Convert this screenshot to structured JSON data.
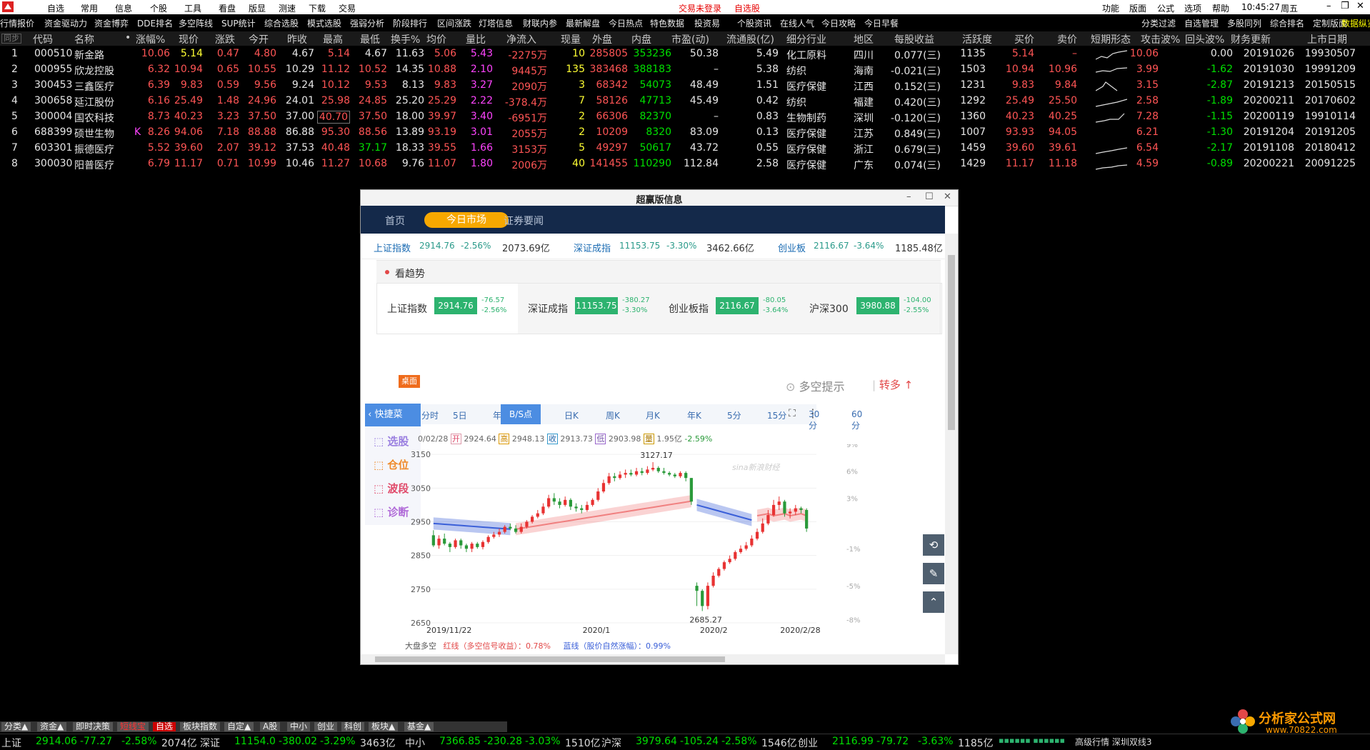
{
  "menubar": {
    "items": [
      "自选",
      "常用",
      "信息",
      "个股",
      "工具",
      "看盘",
      "版显",
      "测速",
      "下载",
      "交易"
    ],
    "status_notlogged": "交易未登录",
    "self_pick_stock": "自选股",
    "right_items": [
      "功能",
      "版面",
      "公式",
      "选项",
      "帮助"
    ],
    "time": "10:45:27",
    "weekday": "周五"
  },
  "toolbar": {
    "left": [
      "行情报价",
      "资金驱动力",
      "资金博弈",
      "DDE排名",
      "多空阵线",
      "SUP统计",
      "综合选股",
      "模式选股",
      "强弱分析",
      "阶段排行",
      "区间涨跌",
      "灯塔信息",
      "财联内参",
      "最新解盘",
      "今日热点",
      "特色数据",
      "投资易",
      "个股资讯",
      "在线人气",
      "今日攻略",
      "今日早餐"
    ],
    "right": [
      "分类过滤",
      "自选管理",
      "多股同列",
      "综合排名",
      "定制版面",
      "数据纵览"
    ]
  },
  "table": {
    "sync_label": "同步",
    "columns": [
      "代码",
      "名称",
      "•",
      "涨幅%",
      "现价",
      "涨跌",
      "今开",
      "昨收",
      "最高",
      "最低",
      "换手%",
      "均价",
      "量比",
      "净流入",
      "现量",
      "外盘",
      "内盘",
      "市盈(动)",
      "流通股(亿)",
      "细分行业",
      "地区",
      "每股收益",
      "活跃度",
      "买价",
      "卖价",
      "短期形态",
      "攻击波%",
      "回头波%",
      "财务更新",
      "上市日期"
    ],
    "rows": [
      {
        "no": "1",
        "code": "000510",
        "name": "新金路",
        "flag": "",
        "chg_pct": "10.06",
        "price": "5.14",
        "chg": "0.47",
        "open": "4.80",
        "pre_close": "4.67",
        "high": "5.14",
        "low": "4.67",
        "turnover": "11.63",
        "avg": "5.06",
        "vol_ratio": "5.43",
        "net_in": "-2275万",
        "cur_vol": "10",
        "outer": "285805",
        "inner": "353236",
        "pe": "50.38",
        "float_shares": "5.49",
        "industry": "化工原料",
        "region": "四川",
        "eps": "0.077(三)",
        "activity": "1135",
        "bid": "5.14",
        "ask": "–",
        "attack": "10.06",
        "pullback": "0.00",
        "fin_update": "20191026",
        "list_date": "19930507"
      },
      {
        "no": "2",
        "code": "000955",
        "name": "欣龙控股",
        "flag": "",
        "chg_pct": "6.32",
        "price": "10.94",
        "chg": "0.65",
        "open": "10.55",
        "pre_close": "10.29",
        "high": "11.12",
        "low": "10.52",
        "turnover": "14.35",
        "avg": "10.88",
        "vol_ratio": "2.10",
        "net_in": "9445万",
        "cur_vol": "135",
        "outer": "383468",
        "inner": "388183",
        "pe": "–",
        "float_shares": "5.38",
        "industry": "纺织",
        "region": "海南",
        "eps": "-0.021(三)",
        "activity": "1503",
        "bid": "10.94",
        "ask": "10.96",
        "attack": "3.99",
        "pullback": "-1.62",
        "fin_update": "20191030",
        "list_date": "19991209"
      },
      {
        "no": "3",
        "code": "300453",
        "name": "三鑫医疗",
        "flag": "",
        "chg_pct": "6.39",
        "price": "9.83",
        "chg": "0.59",
        "open": "9.56",
        "pre_close": "9.24",
        "high": "10.12",
        "low": "9.53",
        "turnover": "8.13",
        "avg": "9.83",
        "vol_ratio": "3.27",
        "net_in": "2090万",
        "cur_vol": "3",
        "outer": "68342",
        "inner": "54073",
        "pe": "48.49",
        "float_shares": "1.51",
        "industry": "医疗保健",
        "region": "江西",
        "eps": "0.152(三)",
        "activity": "1231",
        "bid": "9.83",
        "ask": "9.84",
        "attack": "3.15",
        "pullback": "-2.87",
        "fin_update": "20191213",
        "list_date": "20150515"
      },
      {
        "no": "4",
        "code": "300658",
        "name": "延江股份",
        "flag": "",
        "chg_pct": "6.16",
        "price": "25.49",
        "chg": "1.48",
        "open": "24.96",
        "pre_close": "24.01",
        "high": "25.98",
        "low": "24.85",
        "turnover": "25.20",
        "avg": "25.29",
        "vol_ratio": "2.22",
        "net_in": "-378.4万",
        "cur_vol": "7",
        "outer": "58126",
        "inner": "47713",
        "pe": "45.49",
        "float_shares": "0.42",
        "industry": "纺织",
        "region": "福建",
        "eps": "0.420(三)",
        "activity": "1292",
        "bid": "25.49",
        "ask": "25.50",
        "attack": "2.58",
        "pullback": "-1.89",
        "fin_update": "20200211",
        "list_date": "20170602"
      },
      {
        "no": "5",
        "code": "300004",
        "name": "国农科技",
        "flag": "",
        "chg_pct": "8.73",
        "price": "40.23",
        "chg": "3.23",
        "open": "37.50",
        "pre_close": "37.00",
        "high": "40.70",
        "low": "37.50",
        "turnover": "18.00",
        "avg": "39.97",
        "vol_ratio": "3.40",
        "net_in": "-6951万",
        "cur_vol": "2",
        "outer": "66306",
        "inner": "82370",
        "pe": "–",
        "float_shares": "0.83",
        "industry": "生物制药",
        "region": "深圳",
        "eps": "-0.120(三)",
        "activity": "1360",
        "bid": "40.23",
        "ask": "40.25",
        "attack": "7.28",
        "pullback": "-1.15",
        "fin_update": "20200119",
        "list_date": "19910114"
      },
      {
        "no": "6",
        "code": "688399",
        "name": "硕世生物",
        "flag": "K",
        "chg_pct": "8.26",
        "price": "94.06",
        "chg": "7.18",
        "open": "88.88",
        "pre_close": "86.88",
        "high": "95.30",
        "low": "88.56",
        "turnover": "13.89",
        "avg": "93.19",
        "vol_ratio": "3.01",
        "net_in": "2055万",
        "cur_vol": "2",
        "outer": "10209",
        "inner": "8320",
        "pe": "83.09",
        "float_shares": "0.13",
        "industry": "医疗保健",
        "region": "江苏",
        "eps": "0.849(三)",
        "activity": "1007",
        "bid": "93.93",
        "ask": "94.05",
        "attack": "6.21",
        "pullback": "-1.30",
        "fin_update": "20191204",
        "list_date": "20191205"
      },
      {
        "no": "7",
        "code": "603301",
        "name": "振德医疗",
        "flag": "",
        "chg_pct": "5.52",
        "price": "39.60",
        "chg": "2.07",
        "open": "39.12",
        "pre_close": "37.53",
        "high": "40.48",
        "low": "37.17",
        "turnover": "18.33",
        "avg": "39.55",
        "vol_ratio": "1.66",
        "net_in": "3153万",
        "cur_vol": "5",
        "outer": "49297",
        "inner": "50617",
        "pe": "43.72",
        "float_shares": "0.55",
        "industry": "医疗保健",
        "region": "浙江",
        "eps": "0.679(三)",
        "activity": "1459",
        "bid": "39.60",
        "ask": "39.61",
        "attack": "6.54",
        "pullback": "-2.17",
        "fin_update": "20191108",
        "list_date": "20180412"
      },
      {
        "no": "8",
        "code": "300030",
        "name": "阳普医疗",
        "flag": "",
        "chg_pct": "6.79",
        "price": "11.17",
        "chg": "0.71",
        "open": "10.99",
        "pre_close": "10.46",
        "high": "11.27",
        "low": "10.68",
        "turnover": "9.76",
        "avg": "11.07",
        "vol_ratio": "1.80",
        "net_in": "2006万",
        "cur_vol": "40",
        "outer": "141455",
        "inner": "110290",
        "pe": "112.84",
        "float_shares": "2.58",
        "industry": "医疗保健",
        "region": "广东",
        "eps": "0.074(三)",
        "activity": "1429",
        "bid": "11.17",
        "ask": "11.18",
        "attack": "4.59",
        "pullback": "-0.89",
        "fin_update": "20200221",
        "list_date": "20091225"
      }
    ]
  },
  "popup": {
    "title": "超赢版信息",
    "nav": [
      "首页",
      "今日市场",
      "证券要闻"
    ],
    "index_bar": [
      {
        "name": "上证指数",
        "value": "2914.76",
        "chg": "-2.56%",
        "amount": "2073.69亿"
      },
      {
        "name": "深证成指",
        "value": "11153.75",
        "chg": "-3.30%",
        "amount": "3462.66亿"
      },
      {
        "name": "创业板",
        "value": "2116.67",
        "chg": "-3.64%",
        "amount": "1185.48亿"
      }
    ],
    "trend_title": "看趋势",
    "cards": [
      {
        "name": "上证指数",
        "value": "2914.76",
        "c1": "-76.57",
        "c2": "-2.56%"
      },
      {
        "name": "深证成指",
        "value": "11153.75",
        "c1": "-380.27",
        "c2": "-3.30%"
      },
      {
        "name": "创业板指",
        "value": "2116.67",
        "c1": "-80.05",
        "c2": "-3.64%"
      },
      {
        "name": "沪深300",
        "value": "3980.88",
        "c1": "-104.00",
        "c2": "-2.55%"
      }
    ],
    "desk_badge": "桌面",
    "long_short_tip": "多空提示",
    "turn_long": "转多",
    "tabs": [
      "分时",
      "5日",
      "年线",
      "B/S点",
      "日K",
      "周K",
      "月K",
      "年K",
      "5分",
      "15分",
      "30分",
      "60分"
    ],
    "quick": {
      "header": "快捷菜",
      "items": [
        "选股",
        "仓位",
        "波段",
        "诊断"
      ]
    },
    "ohlc": {
      "date": "0/02/28",
      "open_lbl": "开",
      "open": "2924.64",
      "high_lbl": "高",
      "high": "2948.13",
      "close_lbl": "收",
      "close": "2913.73",
      "low_lbl": "低",
      "low": "2903.98",
      "vol_lbl": "量",
      "vol": "1.95亿",
      "chg": "-2.59%"
    },
    "legend": {
      "title": "大盘多空",
      "red": "红线（多空信号收益）：0.78%",
      "blue": "蓝线（股价自然涨幅）：0.99%"
    },
    "watermark": "sina新浪财经"
  },
  "chart_data": {
    "type": "candlestick",
    "y_left_ticks": [
      "3150",
      "3050",
      "2950",
      "2850",
      "2750",
      "2650"
    ],
    "y_right_ticks": [
      "9%",
      "6%",
      "3%",
      "",
      "-1%",
      "-5%",
      "-8%"
    ],
    "ylim": [
      2650,
      3180
    ],
    "x_ticks": [
      "2019/11/22",
      "2020/1",
      "2020/2",
      "2020/2/28"
    ],
    "annotations": [
      {
        "text": "3127.17"
      },
      {
        "text": "2685.27"
      }
    ],
    "colors": {
      "up": "#e83232",
      "down": "#2a9a3a",
      "red_line": "#f08080",
      "blue_line": "#3a5fd8"
    },
    "candles": [
      [
        2910,
        2880,
        2925,
        2875
      ],
      [
        2880,
        2900,
        2910,
        2870
      ],
      [
        2900,
        2885,
        2915,
        2880
      ],
      [
        2885,
        2875,
        2890,
        2860
      ],
      [
        2875,
        2895,
        2900,
        2870
      ],
      [
        2895,
        2880,
        2900,
        2870
      ],
      [
        2880,
        2870,
        2885,
        2860
      ],
      [
        2870,
        2885,
        2890,
        2860
      ],
      [
        2885,
        2875,
        2890,
        2870
      ],
      [
        2875,
        2890,
        2895,
        2868
      ],
      [
        2890,
        2905,
        2910,
        2885
      ],
      [
        2905,
        2912,
        2920,
        2900
      ],
      [
        2912,
        2920,
        2930,
        2905
      ],
      [
        2920,
        2935,
        2940,
        2915
      ],
      [
        2935,
        2930,
        2945,
        2925
      ],
      [
        2930,
        2920,
        2940,
        2915
      ],
      [
        2920,
        2935,
        2945,
        2915
      ],
      [
        2935,
        2950,
        2955,
        2930
      ],
      [
        2950,
        2965,
        2970,
        2945
      ],
      [
        2965,
        2975,
        2985,
        2960
      ],
      [
        2975,
        2995,
        3005,
        2970
      ],
      [
        2995,
        3020,
        3030,
        2990
      ],
      [
        3020,
        3010,
        3035,
        3000
      ],
      [
        3010,
        3000,
        3020,
        2990
      ],
      [
        3000,
        3015,
        3025,
        2995
      ],
      [
        3015,
        2995,
        3020,
        2985
      ],
      [
        2995,
        2990,
        3005,
        2980
      ],
      [
        2990,
        2985,
        3000,
        2975
      ],
      [
        2985,
        3000,
        3010,
        2980
      ],
      [
        3000,
        3015,
        3020,
        2995
      ],
      [
        3015,
        3040,
        3050,
        3010
      ],
      [
        3040,
        3065,
        3075,
        3035
      ],
      [
        3065,
        3085,
        3095,
        3060
      ],
      [
        3085,
        3080,
        3095,
        3070
      ],
      [
        3080,
        3090,
        3100,
        3075
      ],
      [
        3090,
        3095,
        3105,
        3080
      ],
      [
        3095,
        3090,
        3105,
        3085
      ],
      [
        3090,
        3100,
        3110,
        3085
      ],
      [
        3100,
        3095,
        3110,
        3088
      ],
      [
        3095,
        3105,
        3115,
        3090
      ],
      [
        3105,
        3110,
        3127,
        3100
      ],
      [
        3110,
        3100,
        3115,
        3095
      ],
      [
        3100,
        3095,
        3110,
        3090
      ],
      [
        3095,
        3090,
        3100,
        3085
      ],
      [
        3090,
        3085,
        3095,
        3080
      ],
      [
        3085,
        3095,
        3100,
        3080
      ],
      [
        3095,
        3080,
        3100,
        3070
      ],
      [
        3080,
        3010,
        3080,
        3000
      ],
      [
        2760,
        2745,
        2770,
        2700
      ],
      [
        2745,
        2700,
        2750,
        2685
      ],
      [
        2700,
        2760,
        2770,
        2690
      ],
      [
        2760,
        2790,
        2800,
        2755
      ],
      [
        2790,
        2810,
        2815,
        2785
      ],
      [
        2810,
        2830,
        2835,
        2805
      ],
      [
        2830,
        2840,
        2850,
        2825
      ],
      [
        2840,
        2860,
        2865,
        2835
      ],
      [
        2860,
        2870,
        2880,
        2855
      ],
      [
        2870,
        2880,
        2890,
        2865
      ],
      [
        2880,
        2900,
        2910,
        2875
      ],
      [
        2900,
        2920,
        2930,
        2895
      ],
      [
        2920,
        2945,
        2960,
        2915
      ],
      [
        2945,
        2970,
        2985,
        2940
      ],
      [
        2970,
        3000,
        3015,
        2965
      ],
      [
        3000,
        3010,
        3025,
        2985
      ],
      [
        3010,
        2975,
        3015,
        2965
      ],
      [
        2975,
        2980,
        2990,
        2960
      ],
      [
        2980,
        2990,
        3000,
        2970
      ],
      [
        2990,
        2985,
        2995,
        2975
      ],
      [
        2985,
        2930,
        2990,
        2920
      ]
    ]
  },
  "bottom_tabs": [
    "分类▲",
    "资金▲",
    "即时决策",
    "短线宝",
    "自选",
    "板块指数",
    "自定▲",
    "A股",
    "中小",
    "创业",
    "科创",
    "板块▲",
    "基金▲"
  ],
  "status": [
    {
      "name": "上证",
      "value": "2914.06",
      "chg": "-77.27",
      "pct": "-2.58%",
      "amount": "2074亿"
    },
    {
      "name": "深证",
      "value": "11154.0",
      "chg": "-380.02",
      "pct": "-3.29%",
      "amount": "3463亿"
    },
    {
      "name": "中小",
      "value": "7366.85",
      "chg": "-230.28",
      "pct": "-3.03%",
      "amount": "1510亿"
    },
    {
      "name": "沪深",
      "value": "3979.64",
      "chg": "-105.24",
      "pct": "-2.58%",
      "amount": "1546亿"
    },
    {
      "name": "创业",
      "value": "2116.99",
      "chg": "-79.72",
      "pct": "-3.63%",
      "amount": "1185亿"
    }
  ],
  "status_right": "高级行情 深圳双线3",
  "watermark_text": "分析家公式网",
  "watermark_url": "www.70822.com"
}
